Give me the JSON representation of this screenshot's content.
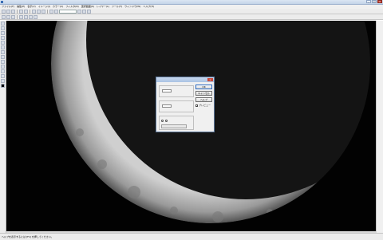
{
  "window": {
    "title": "",
    "buttons": [
      "_",
      "□",
      "×"
    ]
  },
  "menu": [
    "ファイル(F)",
    "編集(E)",
    "表示(V)",
    "イメージ(I)",
    "カラー(C)",
    "フィルタ(R)",
    "選択範囲(S)",
    "レイヤー(L)",
    "ツール(T)",
    "ウィンドウ(W)",
    "ヘルプ(H)"
  ],
  "toolbar": {
    "zoom_value": ""
  },
  "dialog": {
    "title": "",
    "group1": {
      "label": "",
      "row_label": "",
      "value": "",
      "unit": ""
    },
    "group2": {
      "label": "",
      "row_label": "",
      "value": "",
      "unit": ""
    },
    "group3": {
      "label": "",
      "opt1": "",
      "opt2": "",
      "select_value": ""
    },
    "ok": "OK",
    "cancel": "キャンセル",
    "help": "ヘルプ",
    "preview": "プレビュー"
  },
  "status": {
    "hint": "ヘルプを表示するには [F1] を押してください。",
    "position": ""
  },
  "colors": {
    "canvas": "#020202",
    "moon_lit": "#d9d9d9"
  }
}
